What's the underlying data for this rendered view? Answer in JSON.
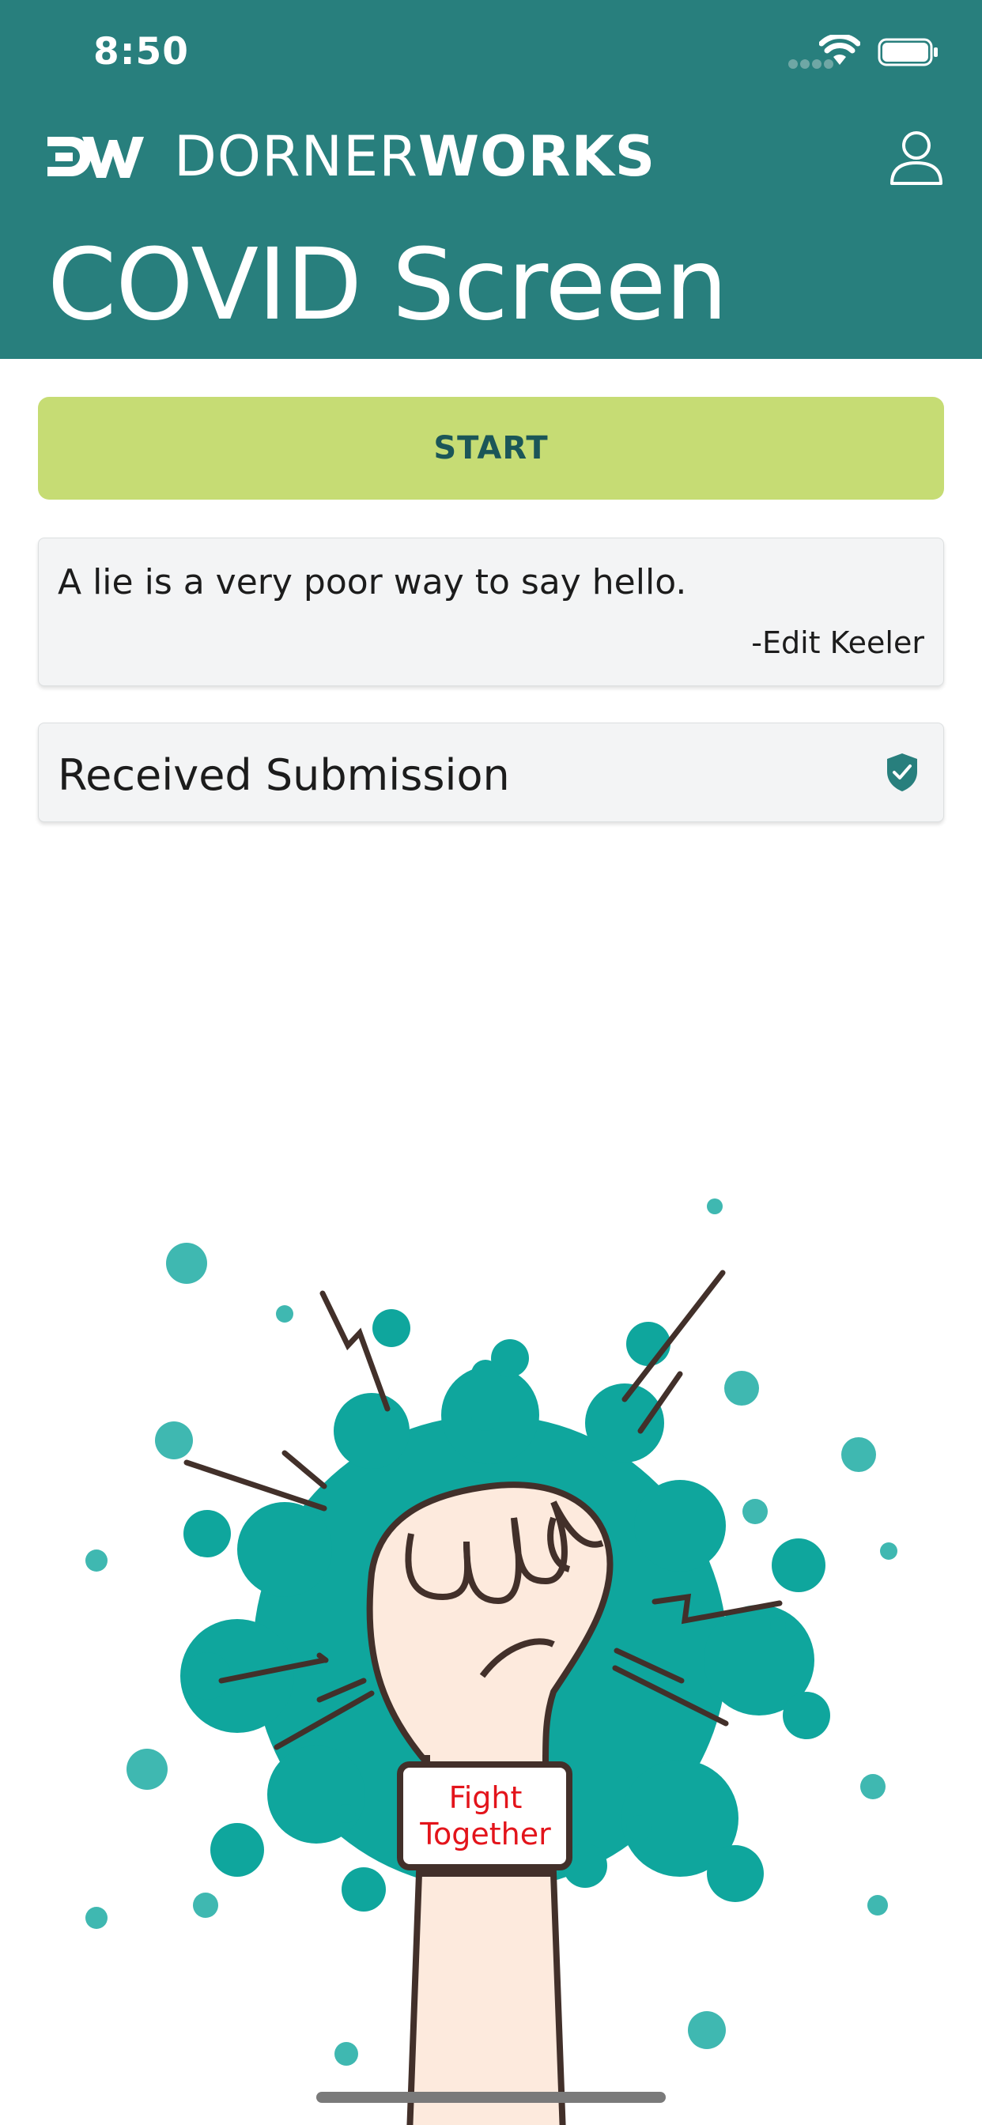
{
  "status_bar": {
    "time": "8:50"
  },
  "header": {
    "logo_light": "DORNER",
    "logo_bold": "WORKS",
    "title": "COVID Screen"
  },
  "start_button": {
    "label": "START"
  },
  "quote": {
    "text": "A lie is a very poor way to say hello.",
    "author": "-Edit Keeler"
  },
  "submission": {
    "label": "Received Submission",
    "status_icon": "shield-check-icon"
  },
  "illustration": {
    "wristband_line1": "Fight",
    "wristband_line2": "Together"
  },
  "colors": {
    "header_bg": "#287f7d",
    "start_bg": "#c6dc74",
    "start_text": "#1b5658",
    "virus": "#0fa69d",
    "wristband_text": "#e3141b"
  }
}
